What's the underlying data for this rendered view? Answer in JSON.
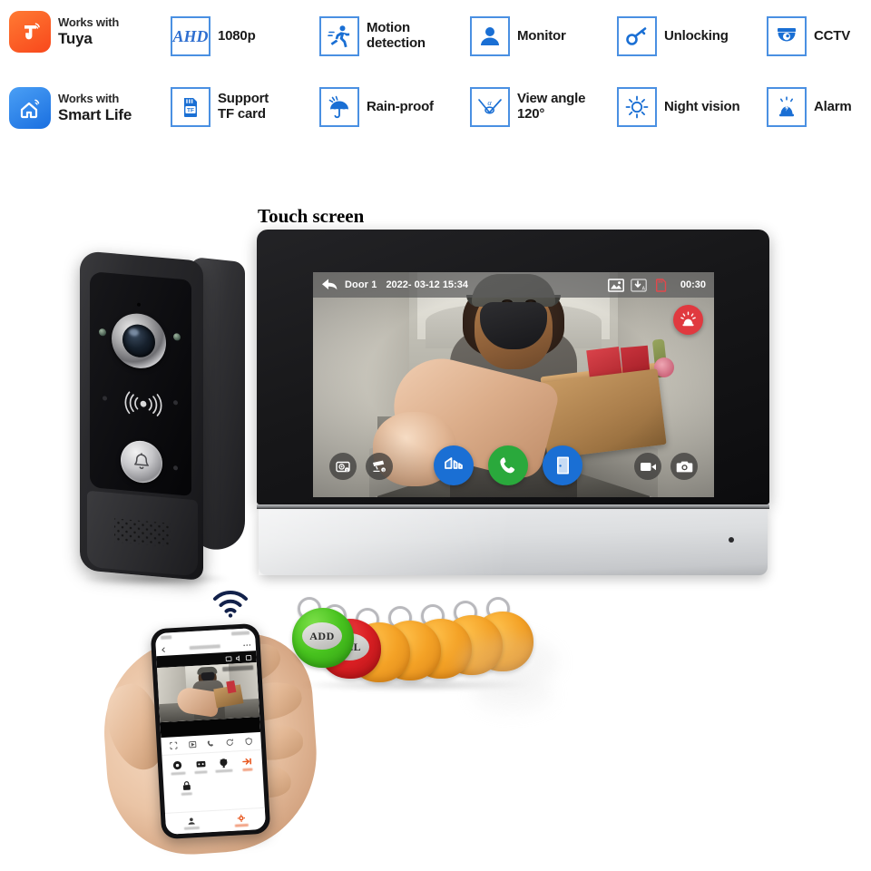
{
  "features": [
    {
      "id": "tuya",
      "icon": "tuya-logo",
      "line1": "Works with",
      "line2": "Tuya",
      "style": "two-line-brand"
    },
    {
      "id": "ahd",
      "icon": "ahd-box-icon",
      "line1": "1080p",
      "line2": "",
      "style": "single"
    },
    {
      "id": "motion",
      "icon": "running-person-icon",
      "line1": "Motion",
      "line2": "detection",
      "style": "two-line"
    },
    {
      "id": "monitor",
      "icon": "person-icon",
      "line1": "Monitor",
      "line2": "",
      "style": "single"
    },
    {
      "id": "unlocking",
      "icon": "key-icon",
      "line1": "Unlocking",
      "line2": "",
      "style": "single"
    },
    {
      "id": "cctv",
      "icon": "dome-camera-icon",
      "line1": "CCTV",
      "line2": "",
      "style": "single"
    },
    {
      "id": "smartlife",
      "icon": "smart-life-logo",
      "line1": "Works with",
      "line2": "Smart Life",
      "style": "two-line-brand"
    },
    {
      "id": "tfcard",
      "icon": "tf-card-icon",
      "line1": "Support",
      "line2": "TF card",
      "style": "two-line"
    },
    {
      "id": "rainproof",
      "icon": "umbrella-icon",
      "line1": "Rain-proof",
      "line2": "",
      "style": "single"
    },
    {
      "id": "viewangle",
      "icon": "view-angle-icon",
      "line1": "View angle",
      "line2": "120°",
      "style": "two-line"
    },
    {
      "id": "night",
      "icon": "sun-icon",
      "line1": "Night vision",
      "line2": "",
      "style": "single"
    },
    {
      "id": "alarm",
      "icon": "siren-icon",
      "line1": "Alarm",
      "line2": "",
      "style": "single"
    }
  ],
  "ahd_badge_text": "AHD",
  "tf_badge_text": "TF",
  "view_angle_symbol": "α",
  "touch_screen_label": "Touch screen",
  "monitor": {
    "osd": {
      "back_icon": "back-arrow-icon",
      "channel": "Door 1",
      "datetime": "2022- 03-12 15:34",
      "gallery_icon": "image-gallery-icon",
      "save_icon": "auto-save-icon",
      "sdcard_icon": "sd-card-icon",
      "timer": "00:30",
      "alarm_icon": "siren-alarm-icon"
    },
    "buttons": [
      {
        "id": "door-1",
        "icon": "door-camera-icon",
        "kind": "small-left"
      },
      {
        "id": "cctv-3",
        "icon": "cctv-camera-icon",
        "kind": "small-left"
      },
      {
        "id": "volume",
        "icon": "volume-icon",
        "kind": "large",
        "color": "#1a6fd4"
      },
      {
        "id": "answer-call",
        "icon": "phone-call-icon",
        "kind": "large",
        "color": "#2aa93c"
      },
      {
        "id": "unlock-door",
        "icon": "open-door-icon",
        "kind": "large",
        "color": "#1a6fd4"
      },
      {
        "id": "record-video",
        "icon": "video-record-icon",
        "kind": "small-right"
      },
      {
        "id": "snapshot",
        "icon": "photo-camera-icon",
        "kind": "small-right"
      }
    ]
  },
  "doorbell": {
    "camera_icon": "camera-lens-icon",
    "rfid_icon": "rfid-wave-icon",
    "bell_icon": "doorbell-bell-icon",
    "speaker_icon": "speaker-grille-icon"
  },
  "phone": {
    "wifi_icon": "wifi-icon",
    "back_icon": "back-arrow-icon",
    "more_icon": "more-options-icon",
    "nav_active_color": "#e8571f"
  },
  "fobs": [
    {
      "id": "add-fob",
      "label": "ADD",
      "color": "green"
    },
    {
      "id": "del-fob",
      "label": "DEL",
      "color": "red"
    },
    {
      "id": "user-fob-1",
      "label": "",
      "color": "orange"
    },
    {
      "id": "user-fob-2",
      "label": "",
      "color": "orange"
    },
    {
      "id": "user-fob-3",
      "label": "",
      "color": "orange"
    },
    {
      "id": "user-fob-4",
      "label": "",
      "color": "orange"
    },
    {
      "id": "user-fob-5",
      "label": "",
      "color": "orange"
    }
  ],
  "colors": {
    "accent_blue": "#4a90e2",
    "icon_blue": "#1a6fd4",
    "answer_green": "#2aa93c",
    "alarm_red": "#e0393f",
    "tuya_orange": "#f8481c",
    "fob_orange": "#f4a226"
  }
}
